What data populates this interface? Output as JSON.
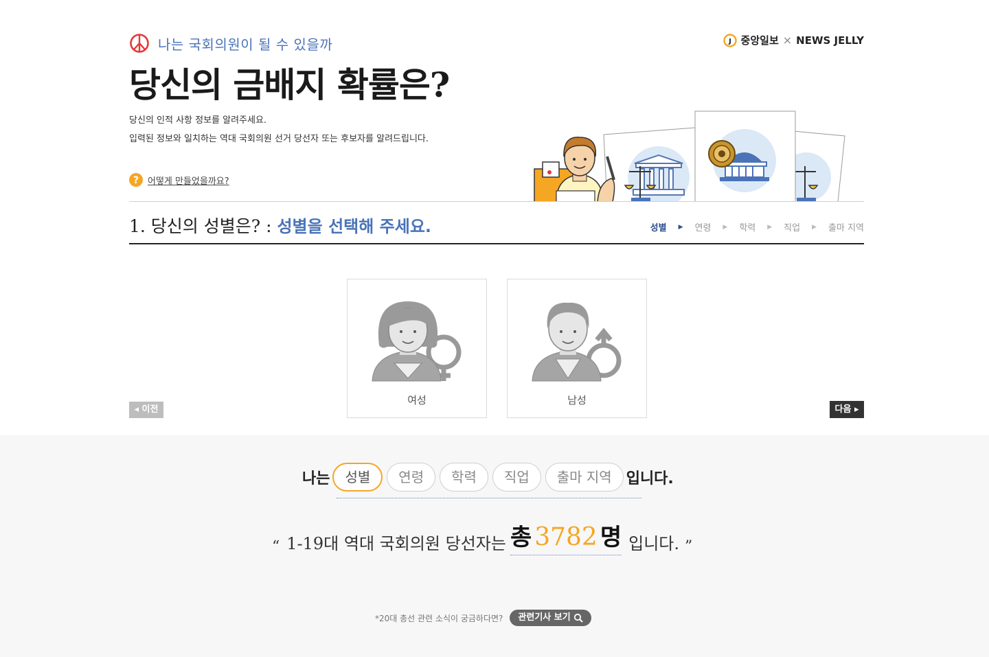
{
  "header": {
    "kicker": "나는 국회의원이 될 수 있을까",
    "title": "당신의 금배지 확률은?",
    "desc_line1": "당신의 인적 사항 정보를 알려주세요.",
    "desc_line2": "입력된 정보와 일치하는 역대 국회의원 선거 당선자 또는 후보자를 알려드립니다.",
    "help_link": "어떻게 만들었을까요?",
    "brand_left": "중앙일보",
    "brand_sep": "×",
    "brand_right": "NEWS JELLY"
  },
  "question": {
    "prefix": "1. 당신의 성별은? : ",
    "hint": "성별을 선택해 주세요.",
    "steps": [
      "성별",
      "연령",
      "학력",
      "직업",
      "출마 지역"
    ]
  },
  "choices": {
    "female_label": "여성",
    "male_label": "남성"
  },
  "nav": {
    "prev_label": "◂ 이전",
    "next_label": "다음 ▸"
  },
  "summary": {
    "lead": "나는",
    "pills": [
      "성별",
      "연령",
      "학력",
      "직업",
      "출마 지역"
    ],
    "tail": "입니다."
  },
  "result": {
    "open_quote": "“",
    "text_before": "1-19대 역대 국회의원 당선자는",
    "total_prefix": "총",
    "count": "3782",
    "total_suffix": "명",
    "text_after": "입니다.",
    "close_quote": "”"
  },
  "footer": {
    "note": "*20대 총선 관련 소식이 궁금하다면?",
    "button_label": "관련기사 보기"
  },
  "colors": {
    "accent_blue": "#4a73b8",
    "accent_orange": "#f5a623",
    "logo_red": "#e53935"
  }
}
